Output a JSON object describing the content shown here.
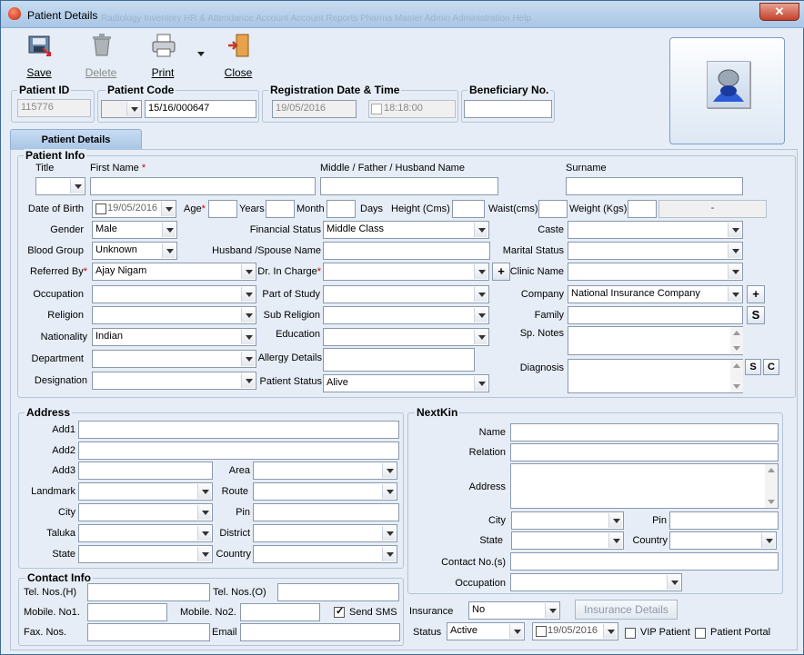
{
  "window": {
    "title": "Patient Details",
    "close": "✕",
    "background_menu": "Radiology   Inventory   HR & Attendance   Account   Account Reports   Pharma   Master   Admin   Administration   Help"
  },
  "toolbar": {
    "save": "Save",
    "delete": "Delete",
    "print": "Print",
    "close": "Close"
  },
  "header": {
    "patient_id_label": "Patient ID",
    "patient_id": "115776",
    "patient_code_label": "Patient Code",
    "patient_code": "15/16/000647",
    "reg_label": "Registration Date & Time",
    "reg_date": "19/05/2016",
    "reg_time": "18:18:00",
    "beneficiary_label": "Beneficiary No.",
    "beneficiary": ""
  },
  "tab": "Patient Details",
  "patient_info": {
    "legend": "Patient Info",
    "title": "Title",
    "first_name": "First Name",
    "middle": "Middle / Father / Husband Name",
    "surname": "Surname",
    "dob_label": "Date of Birth",
    "dob": "19/05/2016",
    "age": "Age",
    "years": "Years",
    "month": "Month",
    "days": "Days",
    "height": "Height (Cms)",
    "waist": "Waist(cms)",
    "weight": "Weight (Kgs)",
    "bmi": "-",
    "gender_label": "Gender",
    "gender": "Male",
    "financial_label": "Financial Status",
    "financial": "Middle Class",
    "caste": "Caste",
    "blood_label": "Blood Group",
    "blood": "Unknown",
    "spouse": "Husband /Spouse Name",
    "marital": "Marital Status",
    "referred_label": "Referred By",
    "referred": "Ajay Nigam",
    "dr_label": "Dr. In Charge",
    "clinic": "Clinic Name",
    "occupation": "Occupation",
    "part_study": "Part of Study",
    "company_label": "Company",
    "company": "National Insurance Company",
    "religion": "Religion",
    "sub_religion": "Sub Religion",
    "family": "Family",
    "nationality_label": "Nationality",
    "nationality": "Indian",
    "education": "Education",
    "sp_notes": "Sp. Notes",
    "department": "Department",
    "allergy": "Allergy Details",
    "designation": "Designation",
    "patient_status_label": "Patient Status",
    "patient_status": "Alive",
    "diagnosis": "Diagnosis",
    "plus": "+",
    "s": "S",
    "c": "C"
  },
  "address": {
    "legend": "Address",
    "add1": "Add1",
    "add2": "Add2",
    "add3": "Add3",
    "area": "Area",
    "landmark": "Landmark",
    "route": "Route",
    "city": "City",
    "pin": "Pin",
    "taluka": "Taluka",
    "district": "District",
    "state": "State",
    "country": "Country"
  },
  "nextkin": {
    "legend": "NextKin",
    "name": "Name",
    "relation": "Relation",
    "address": "Address",
    "city": "City",
    "pin": "Pin",
    "state": "State",
    "country": "Country",
    "contact": "Contact No.(s)",
    "occupation": "Occupation"
  },
  "contact": {
    "legend": "Contact Info",
    "tel_h": "Tel. Nos.(H)",
    "tel_o": "Tel. Nos.(O)",
    "mobile1": "Mobile. No1.",
    "mobile2": "Mobile. No2.",
    "send_sms": "Send SMS",
    "fax": "Fax. Nos.",
    "email": "Email"
  },
  "footer": {
    "insurance_label": "Insurance",
    "insurance": "No",
    "insurance_details": "Insurance Details",
    "status_label": "Status",
    "status": "Active",
    "status_date": "19/05/2016",
    "vip": "VIP Patient",
    "portal": "Patient Portal"
  }
}
